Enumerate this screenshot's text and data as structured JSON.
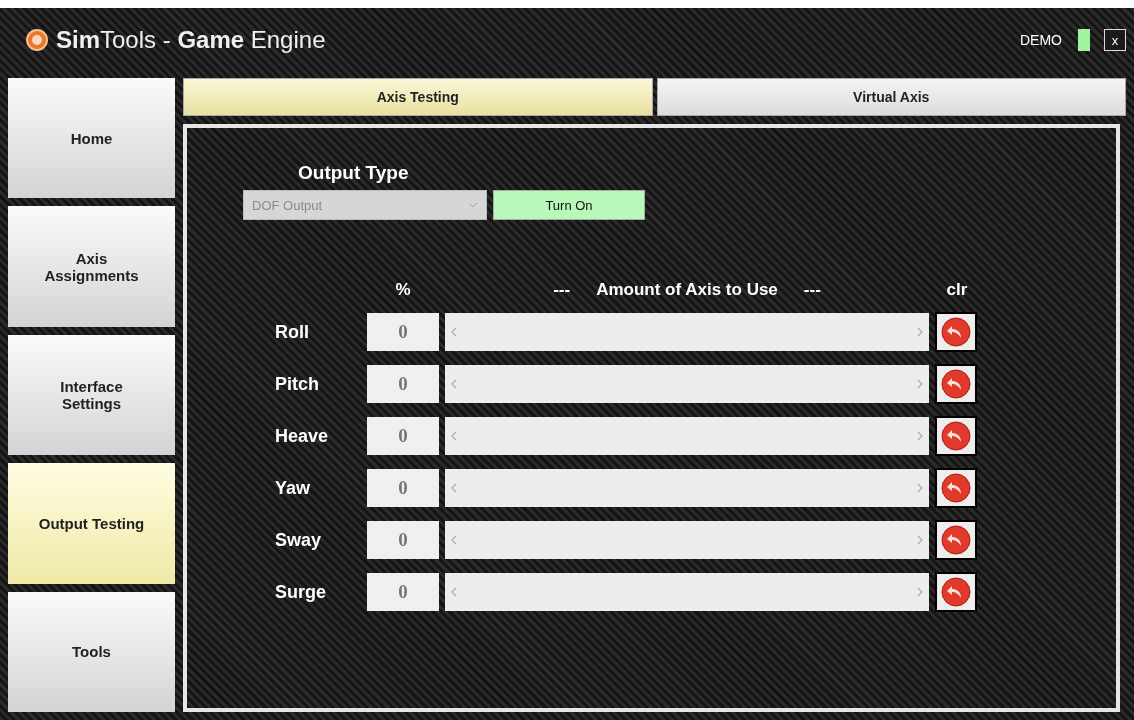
{
  "window": {
    "title_bold_1": "Sim",
    "title_1": "Tools - ",
    "title_bold_2": "Game",
    "title_2": " Engine",
    "badge": "DEMO",
    "close": "x"
  },
  "sidebar": {
    "items": [
      {
        "label": "Home",
        "selected": false
      },
      {
        "label": "Axis Assignments",
        "selected": false
      },
      {
        "label": "Interface Settings",
        "selected": false
      },
      {
        "label": "Output Testing",
        "selected": true
      },
      {
        "label": "Tools",
        "selected": false
      }
    ]
  },
  "tabs": [
    {
      "label": "Axis Testing",
      "selected": true
    },
    {
      "label": "Virtual Axis",
      "selected": false
    }
  ],
  "output_type": {
    "label": "Output Type",
    "value": "DOF Output",
    "disabled": true,
    "button": "Turn On"
  },
  "axes_header": {
    "percent": "%",
    "dash_left": "---",
    "title": "Amount of Axis to Use",
    "dash_right": "---",
    "clear": "clr"
  },
  "axes": [
    {
      "name": "Roll",
      "value": "0",
      "level": 0
    },
    {
      "name": "Pitch",
      "value": "0",
      "level": 0
    },
    {
      "name": "Heave",
      "value": "0",
      "level": 0
    },
    {
      "name": "Yaw",
      "value": "0",
      "level": 0
    },
    {
      "name": "Sway",
      "value": "0",
      "level": 0
    },
    {
      "name": "Surge",
      "value": "0",
      "level": 0
    }
  ]
}
